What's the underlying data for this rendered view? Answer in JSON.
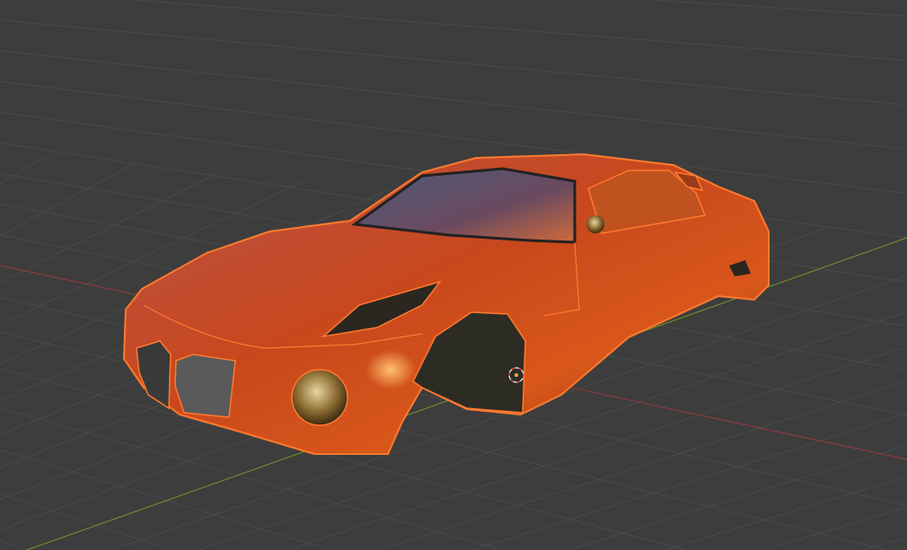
{
  "viewport": {
    "mode": "3d-viewport",
    "background_color": "#3d3d3d",
    "grid_color": "#4a4a4a",
    "x_axis_color": "#8a3b3f",
    "y_axis_color": "#6a8a2e"
  },
  "object": {
    "selected": true,
    "body_color": "#c2441c",
    "outline_color": "#ff7a2e",
    "glass_color": "#5a4a66",
    "interior_color": "#2a2a22",
    "origin_icon": "object-origin-icon"
  }
}
